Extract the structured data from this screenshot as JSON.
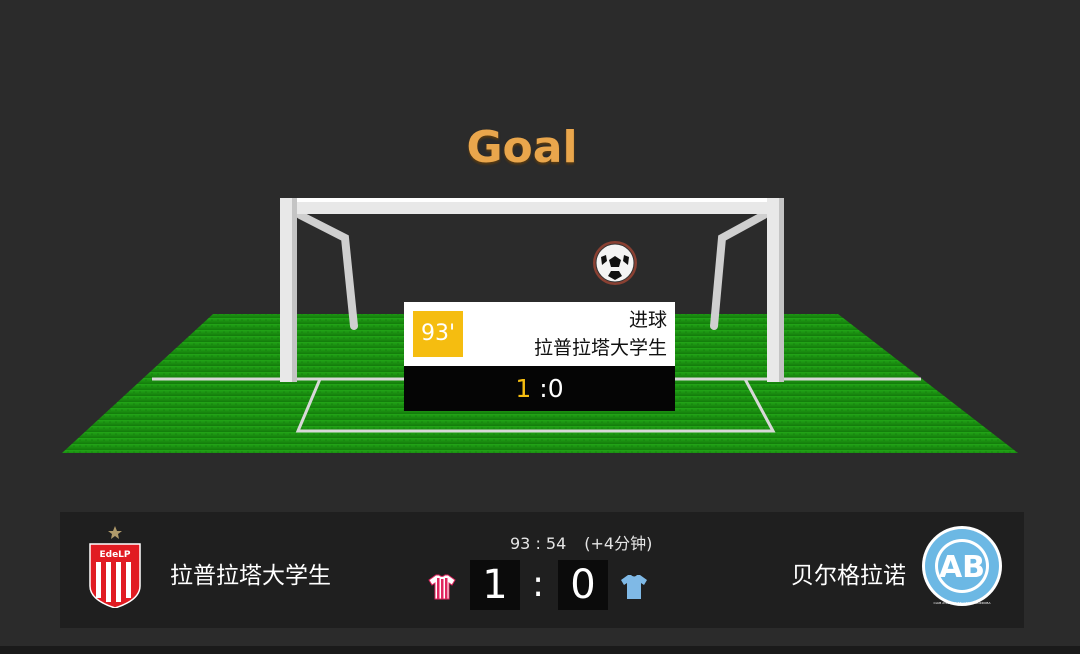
{
  "banner": {
    "title": "Goal"
  },
  "event": {
    "minute": "93'",
    "type": "进球",
    "team": "拉普拉塔大学生",
    "score_home": "1",
    "score_sep": " :",
    "score_away": "0"
  },
  "match": {
    "home_team": "拉普拉塔大学生",
    "away_team": "贝尔格拉诺",
    "clock": "93 : 54",
    "added_time": "(+4分钟)",
    "home_score": "1",
    "separator": ":",
    "away_score": "0",
    "home_logo_text": "EdeLP",
    "away_logo_text": "CLUB ATLETICO BELGRANO CORDOBA"
  },
  "colors": {
    "goal_title": "#e9a64c",
    "minute_badge": "#f5bd10",
    "pitch": "#1f8a12",
    "background": "#2b2b2b",
    "scorebar": "#1f1f1f",
    "home_kit": "#e0245e",
    "away_kit": "#7fb9e6"
  },
  "icons": {
    "ball": "soccer-ball-icon",
    "home_shirt": "striped-shirt-icon",
    "away_shirt": "plain-shirt-icon"
  }
}
